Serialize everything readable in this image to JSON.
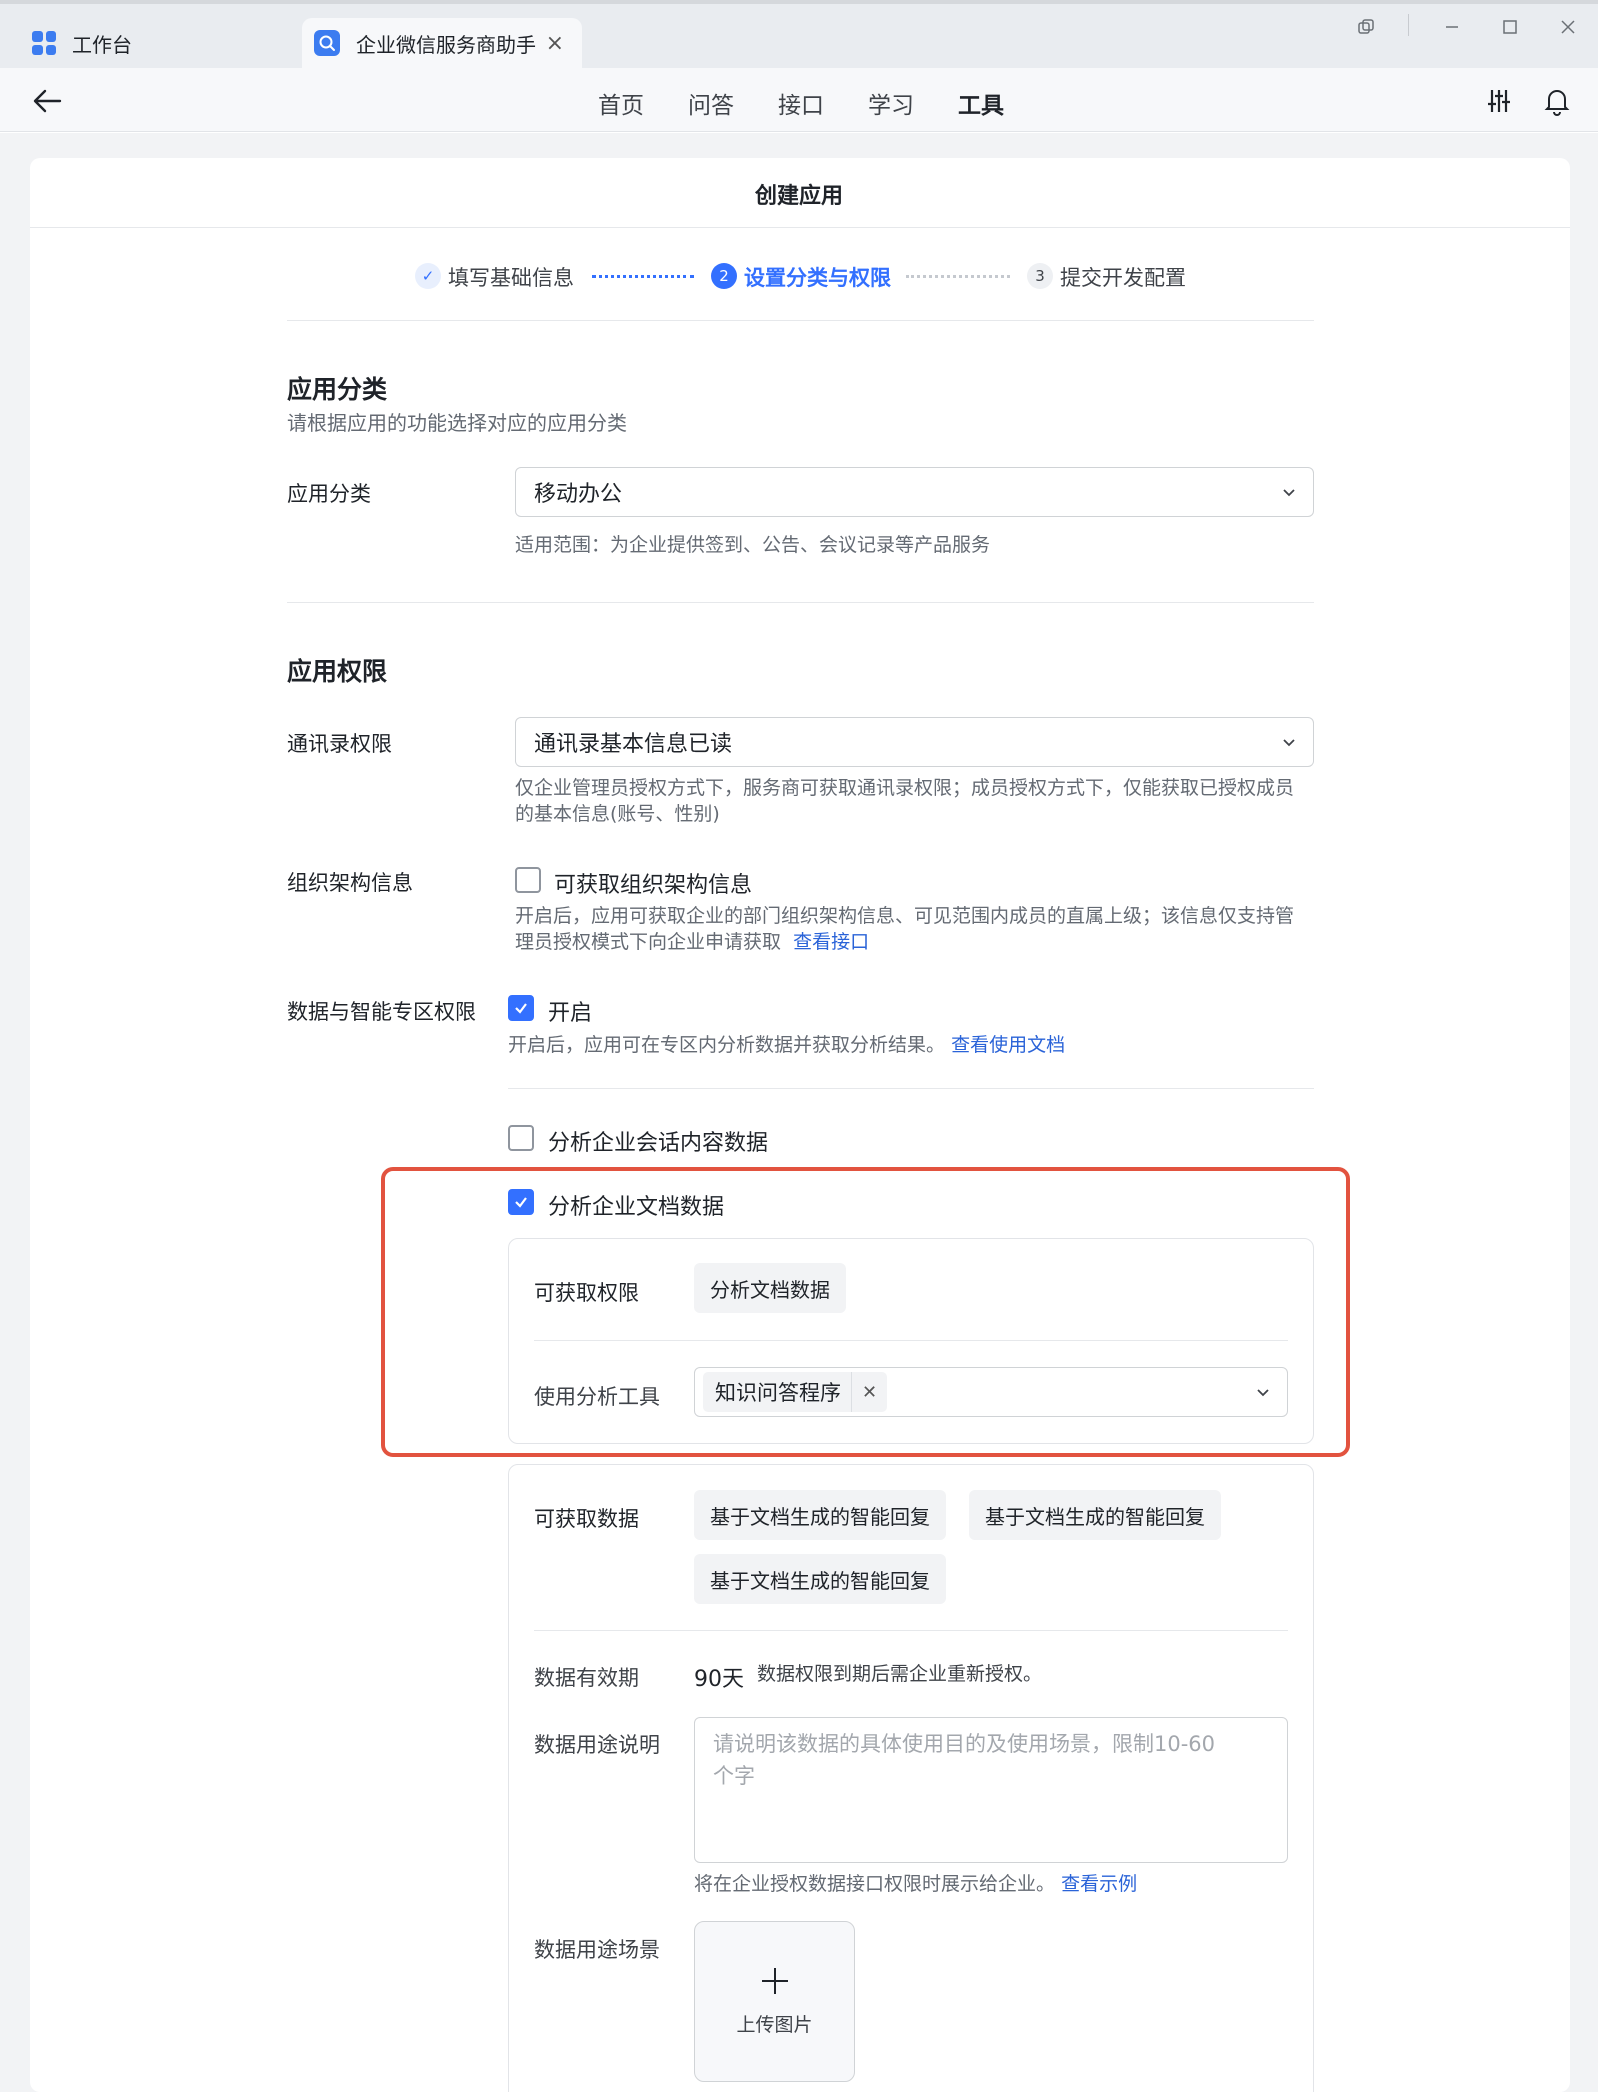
{
  "window": {
    "tabs": [
      {
        "label": "工作台",
        "icon": "grid-icon"
      },
      {
        "label": "企业微信服务商助手",
        "icon": "app-icon"
      }
    ]
  },
  "nav": {
    "items": [
      "首页",
      "问答",
      "接口",
      "学习",
      "工具"
    ],
    "active": "工具"
  },
  "page": {
    "title": "创建应用"
  },
  "steps": [
    {
      "number": "✓",
      "label": "填写基础信息",
      "state": "done"
    },
    {
      "number": "2",
      "label": "设置分类与权限",
      "state": "active"
    },
    {
      "number": "3",
      "label": "提交开发配置",
      "state": "pending"
    }
  ],
  "category": {
    "heading": "应用分类",
    "description": "请根据应用的功能选择对应的应用分类",
    "field_label": "应用分类",
    "selected": "移动办公",
    "scope_hint": "适用范围：为企业提供签到、公告、会议记录等产品服务"
  },
  "permissions": {
    "heading": "应用权限",
    "contacts": {
      "label": "通讯录权限",
      "selected": "通讯录基本信息已读",
      "hint_line1": "仅企业管理员授权方式下，服务商可获取通讯录权限；成员授权方式下，仅能获取已授权成员",
      "hint_line2": "的基本信息(账号、性别)"
    },
    "org": {
      "label": "组织架构信息",
      "checkbox_label": "可获取组织架构信息",
      "checked": false,
      "hint_line1": "开启后，应用可获取企业的部门组织架构信息、可见范围内成员的直属上级；该信息仅支持管",
      "hint_line2": "理员授权模式下向企业申请获取",
      "link": "查看接口"
    },
    "data_zone": {
      "label": "数据与智能专区权限",
      "checkbox_label": "开启",
      "checked": true,
      "hint": "开启后，应用可在专区内分析数据并获取分析结果。",
      "link": "查看使用文档"
    },
    "analyze_chat": {
      "label": "分析企业会话内容数据",
      "checked": false
    },
    "analyze_docs": {
      "label": "分析企业文档数据",
      "checked": true,
      "perm_label": "可获取权限",
      "perm_value": "分析文档数据",
      "tool_label": "使用分析工具",
      "tool_tag": "知识问答程序"
    },
    "data_panel": {
      "data_label": "可获取数据",
      "data_items": [
        "基于文档生成的智能回复",
        "基于文档生成的智能回复",
        "基于文档生成的智能回复"
      ],
      "validity_label": "数据有效期",
      "validity_value": "90天",
      "validity_hint": "数据权限到期后需企业重新授权。",
      "purpose_label": "数据用途说明",
      "purpose_placeholder_line1": "请说明该数据的具体使用目的及使用场景，限制10-60",
      "purpose_placeholder_line2": "个字",
      "purpose_hint": "将在企业授权数据接口权限时展示给企业。",
      "purpose_link": "查看示例",
      "scene_label": "数据用途场景",
      "upload_label": "上传图片"
    }
  },
  "colors": {
    "accent": "#3370ff",
    "link": "#2a63d8",
    "highlight_border": "#e2533f",
    "page_bg": "#f2f3f5"
  }
}
